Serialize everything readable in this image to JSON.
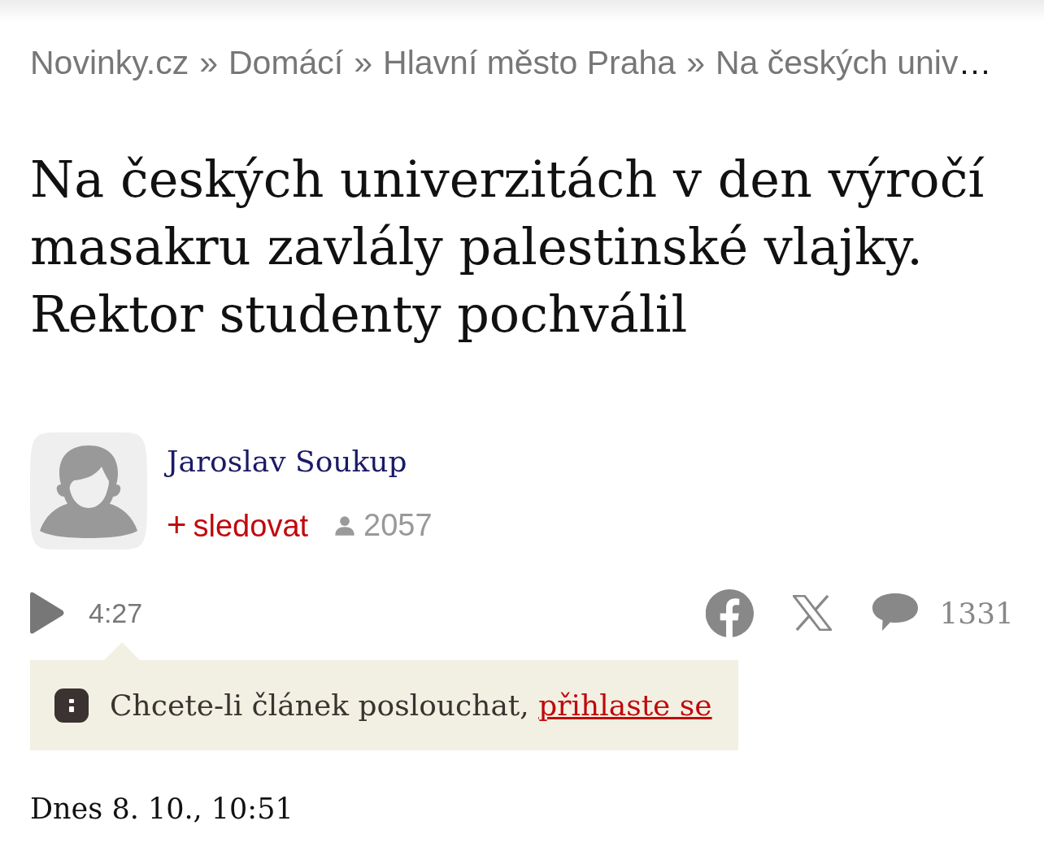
{
  "breadcrumb": {
    "items": [
      {
        "kind": "link",
        "text": "Novinky.cz"
      },
      {
        "kind": "separator",
        "text": "»"
      },
      {
        "kind": "link",
        "text": "Domácí"
      },
      {
        "kind": "separator",
        "text": "»"
      },
      {
        "kind": "link",
        "text": "Hlavní město Praha"
      },
      {
        "kind": "separator",
        "text": "»"
      },
      {
        "kind": "current",
        "text": "Na českých univ",
        "ellipsis": "…"
      }
    ]
  },
  "headline": "Na českých univerzitách v den výročí masakru zavlály palestinské vlajky. Rektor studenty pochválil",
  "author": {
    "name": "Jaroslav Soukup",
    "follow": {
      "icon": "+",
      "label": "sledovat"
    },
    "followers": "2057"
  },
  "audio": {
    "duration": "4:27"
  },
  "share": {
    "comments": "1331"
  },
  "notice": {
    "text": "Chcete-li článek poslouchat,",
    "link": "přihlaste se"
  },
  "date": "Dnes 8. 10., 10:51"
}
